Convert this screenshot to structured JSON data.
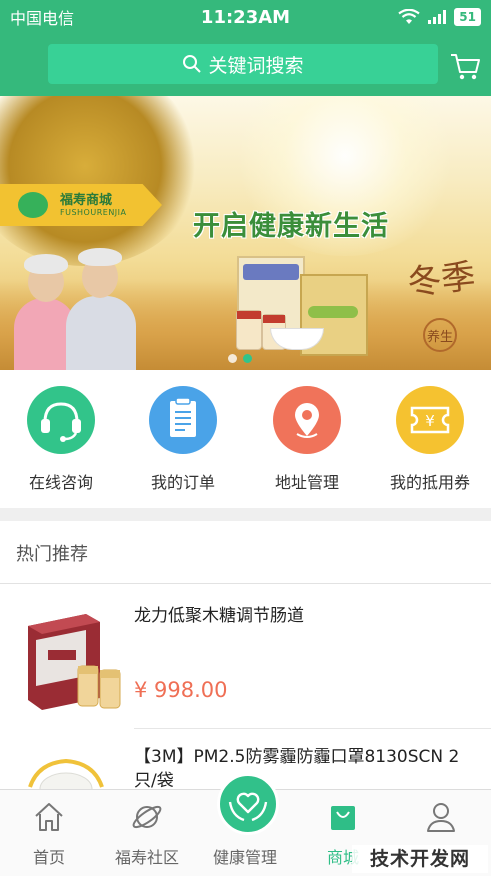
{
  "status_bar": {
    "carrier": "中国电信",
    "time": "11:23AM",
    "battery": "51",
    "icons": [
      "wifi-icon",
      "signal-icon",
      "battery-icon"
    ]
  },
  "header": {
    "search_placeholder": "关键词搜索",
    "search_icon": "search-icon",
    "cart_icon": "cart-icon"
  },
  "banner": {
    "brand_name": "福寿商城",
    "brand_sub": "FUSHOURENJIA",
    "slogan": "开启健康新生活",
    "season_text": "冬季",
    "season_seal": "养生",
    "carousel_count": 2,
    "carousel_active": 2
  },
  "quick_actions": [
    {
      "label": "在线咨询",
      "icon": "headset-icon",
      "color": "#32c48a"
    },
    {
      "label": "我的订单",
      "icon": "order-list-icon",
      "color": "#4aa3e8"
    },
    {
      "label": "地址管理",
      "icon": "location-pin-icon",
      "color": "#f0735a"
    },
    {
      "label": "我的抵用券",
      "icon": "yuan-coupon-icon",
      "color": "#f5c230"
    }
  ],
  "section": {
    "title": "热门推荐"
  },
  "products": [
    {
      "name": "龙力低聚木糖调节肠道",
      "price": "¥ 998.00"
    },
    {
      "name": "【3M】PM2.5防雾霾防霾口罩8130SCN 2只/袋",
      "price": ""
    }
  ],
  "tabbar": {
    "tabs": [
      {
        "label": "首页",
        "icon": "home-icon"
      },
      {
        "label": "福寿社区",
        "icon": "planet-icon"
      },
      {
        "label": "健康管理",
        "icon": "heart-hands-icon"
      },
      {
        "label": "商城",
        "icon": "shopping-bag-icon"
      },
      {
        "label": "",
        "icon": "user-icon"
      }
    ],
    "active": "商城"
  },
  "watermark": "技术开发网",
  "colors": {
    "primary_green": "#35b97c",
    "search_bg": "#38d196",
    "price_red": "#ef6f55",
    "active_tab": "#2fbe87"
  }
}
